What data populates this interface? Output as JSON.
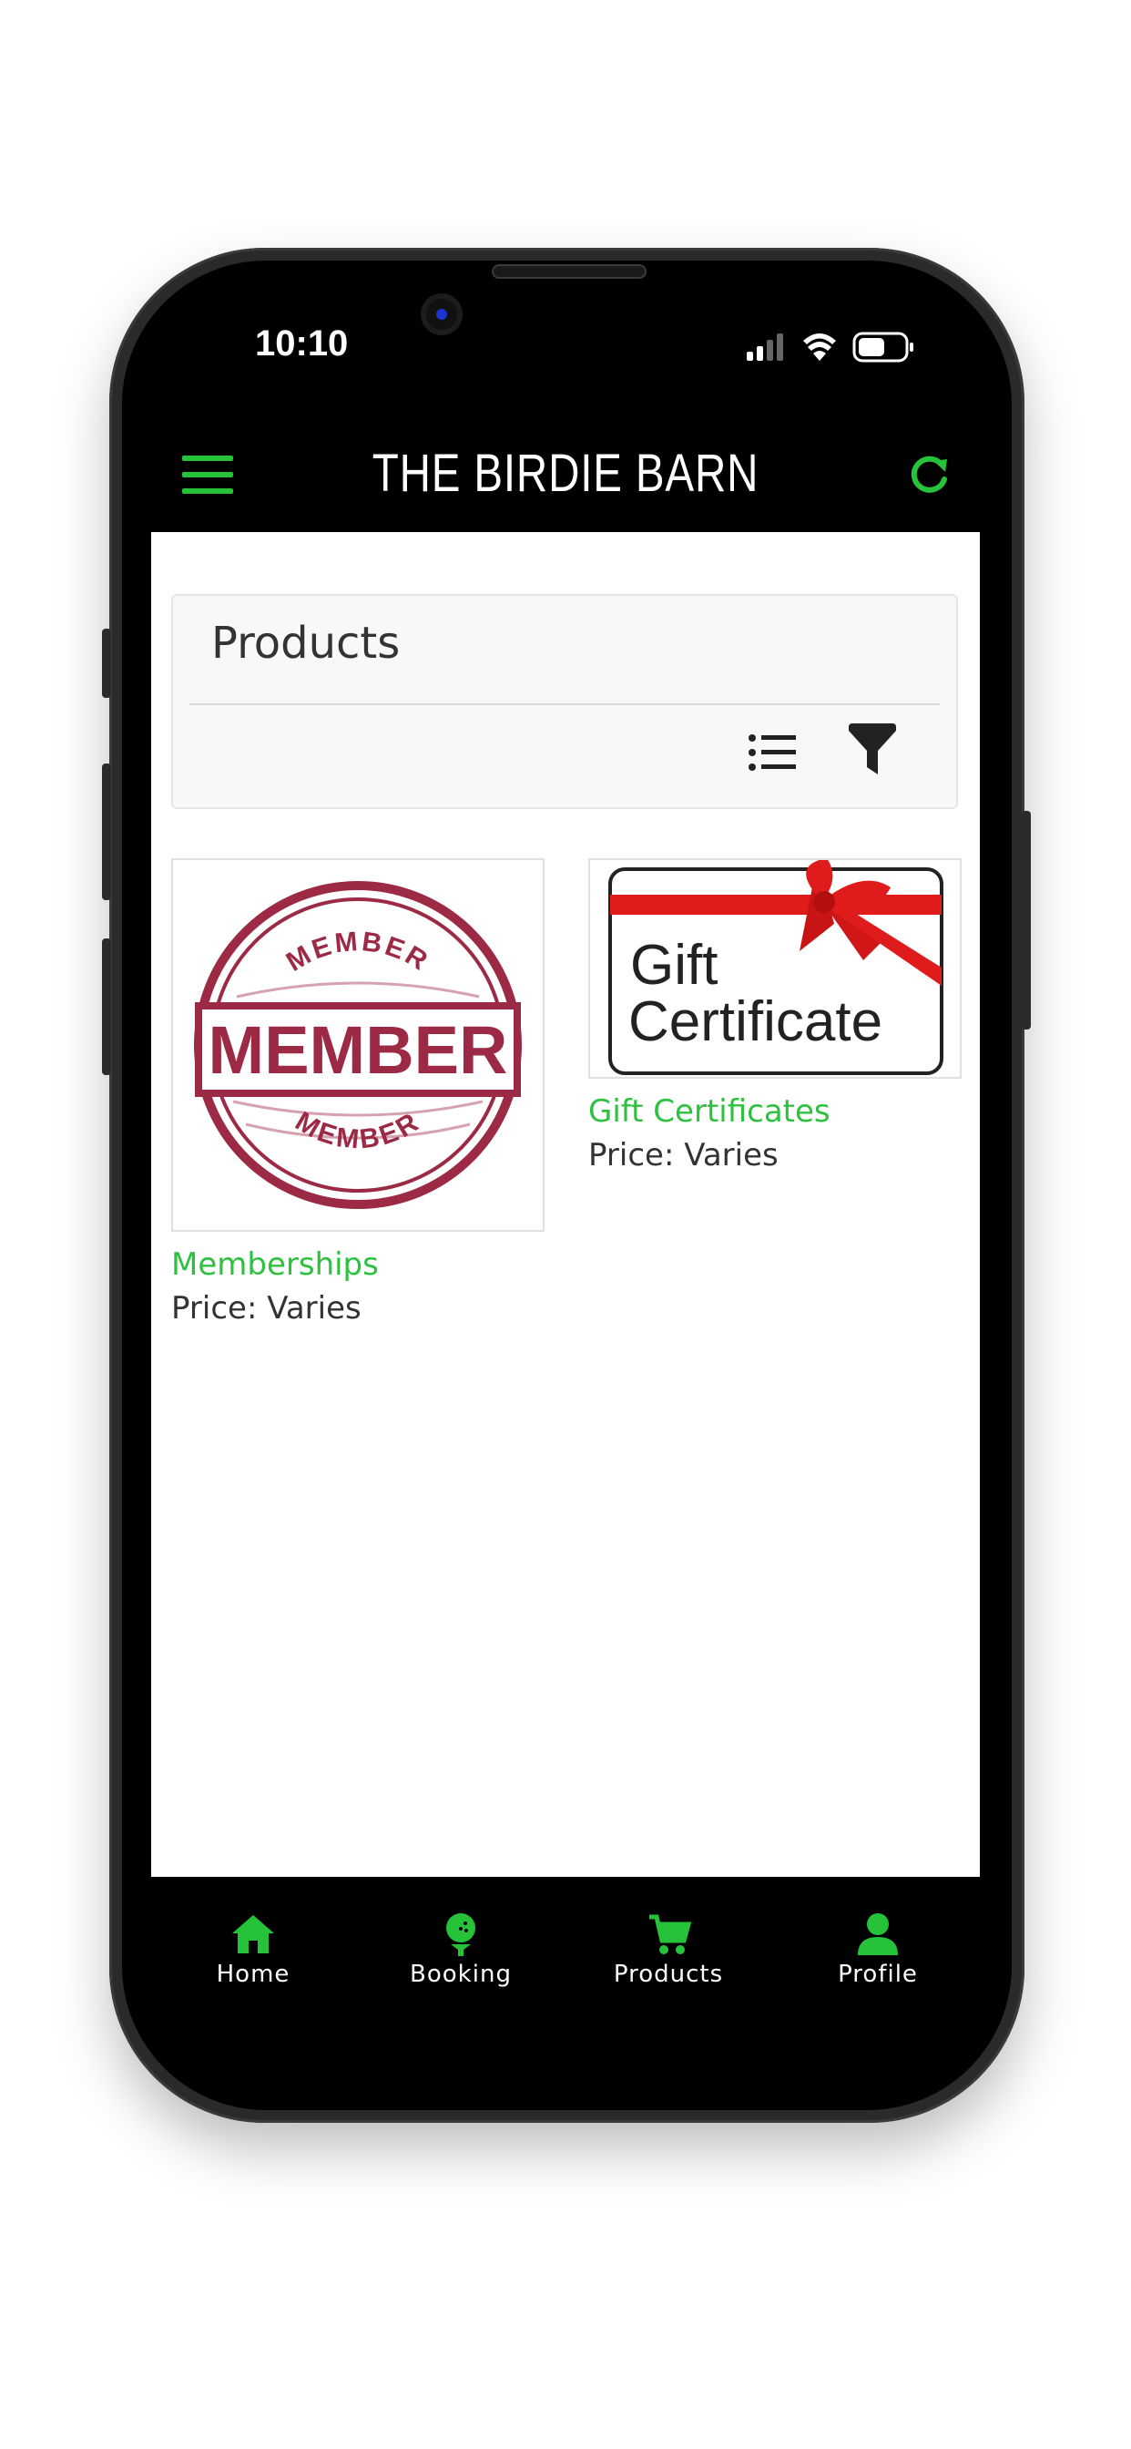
{
  "status_bar": {
    "time": "10:10"
  },
  "header": {
    "title": "THE BIRDIE BARN",
    "accent_color": "#25c23a",
    "menu_icon": "hamburger-icon",
    "refresh_icon": "refresh-icon"
  },
  "products_panel": {
    "title": "Products",
    "list_icon": "list-view-icon",
    "filter_icon": "filter-icon"
  },
  "products": [
    {
      "name": "Memberships",
      "price": "Price: Varies",
      "image_label": "MEMBER",
      "image_ring_text": "MEMBER"
    },
    {
      "name": "Gift Certificates",
      "price": "Price: Varies",
      "image_line1": "Gift",
      "image_line2": "Certificate"
    }
  ],
  "bottom_nav": [
    {
      "label": "Home",
      "icon": "home-icon"
    },
    {
      "label": "Booking",
      "icon": "golf-ball-tee-icon"
    },
    {
      "label": "Products",
      "icon": "cart-icon"
    },
    {
      "label": "Profile",
      "icon": "user-icon"
    }
  ]
}
